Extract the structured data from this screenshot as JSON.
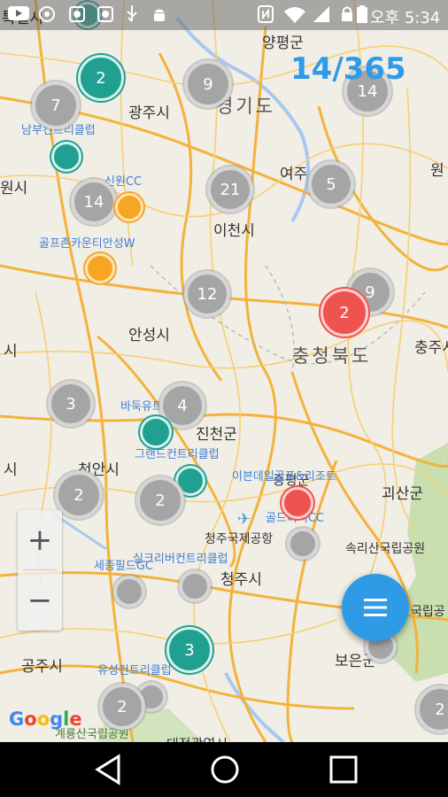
{
  "status": {
    "time": "오후 5:34",
    "left_text": "특별시"
  },
  "counter": "14/365",
  "places": [
    {
      "id": "yangpyeong",
      "text": "양평군"
    },
    {
      "id": "gyeonggi",
      "text": "경기도"
    },
    {
      "id": "gwangju",
      "text": "광주시"
    },
    {
      "id": "yeoju",
      "text": "여주"
    },
    {
      "id": "won",
      "text": "원"
    },
    {
      "id": "wonsi",
      "text": "원시"
    },
    {
      "id": "icheon",
      "text": "이천시"
    },
    {
      "id": "anseong",
      "text": "안성시"
    },
    {
      "id": "chungbuk",
      "text": "충청북도"
    },
    {
      "id": "chungju",
      "text": "충주시"
    },
    {
      "id": "si-left",
      "text": "시"
    },
    {
      "id": "jincheon",
      "text": "진천군"
    },
    {
      "id": "cheonan",
      "text": "천안시"
    },
    {
      "id": "si-left2",
      "text": "시"
    },
    {
      "id": "goesan",
      "text": "괴산군"
    },
    {
      "id": "jeungpyeong",
      "text": "증평군"
    },
    {
      "id": "airport",
      "text": "청주국제공항"
    },
    {
      "id": "cheongju",
      "text": "청주시"
    },
    {
      "id": "songnisan",
      "text": "속리산국립공원"
    },
    {
      "id": "gongju",
      "text": "공주시"
    },
    {
      "id": "boeun",
      "text": "보은군"
    },
    {
      "id": "national-park",
      "text": "국립공"
    },
    {
      "id": "daejeon",
      "text": "대전광역시"
    }
  ],
  "pois": [
    {
      "id": "nambu-cc",
      "text": "남부컨트리클럽"
    },
    {
      "id": "sinwon-cc",
      "text": "신원CC"
    },
    {
      "id": "golfzone",
      "text": "골프존카운티안성W"
    },
    {
      "id": "baduk",
      "text": "바둑유트GC"
    },
    {
      "id": "grand-cc",
      "text": "그랜드컨트리클럽"
    },
    {
      "id": "ilgong",
      "text": "이븐데일골프&리조트"
    },
    {
      "id": "golf-cc",
      "text": "골드리치CC"
    },
    {
      "id": "sejong",
      "text": "세종필드GC"
    },
    {
      "id": "silk-cc",
      "text": "실크리버컨트리클럽"
    },
    {
      "id": "yuseong",
      "text": "유성컨트리클럽"
    },
    {
      "id": "gyeryong",
      "text": "계룡산국립공원"
    }
  ],
  "markers": [
    {
      "id": "m-top-teal",
      "type": "teal",
      "label": ""
    },
    {
      "id": "m-2-teal",
      "type": "teal",
      "label": "2"
    },
    {
      "id": "m-7",
      "type": "gray",
      "label": "7"
    },
    {
      "id": "m-9-top",
      "type": "gray",
      "label": "9"
    },
    {
      "id": "m-14-top",
      "type": "gray",
      "label": "14"
    },
    {
      "id": "m-teal-a",
      "type": "teal",
      "label": ""
    },
    {
      "id": "m-14",
      "type": "gray",
      "label": "14"
    },
    {
      "id": "m-orange-a",
      "type": "orange",
      "label": ""
    },
    {
      "id": "m-21",
      "type": "gray",
      "label": "21"
    },
    {
      "id": "m-5",
      "type": "gray",
      "label": "5"
    },
    {
      "id": "m-orange-b",
      "type": "orange",
      "label": ""
    },
    {
      "id": "m-12",
      "type": "gray",
      "label": "12"
    },
    {
      "id": "m-9-right",
      "type": "gray",
      "label": "9"
    },
    {
      "id": "m-2-red",
      "type": "red",
      "label": "2"
    },
    {
      "id": "m-3",
      "type": "gray",
      "label": "3"
    },
    {
      "id": "m-4",
      "type": "gray",
      "label": "4"
    },
    {
      "id": "m-teal-b",
      "type": "teal",
      "label": ""
    },
    {
      "id": "m-teal-c",
      "type": "teal",
      "label": ""
    },
    {
      "id": "m-2-a",
      "type": "gray",
      "label": "2"
    },
    {
      "id": "m-2-b",
      "type": "gray",
      "label": "2"
    },
    {
      "id": "m-red-b",
      "type": "red",
      "label": ""
    },
    {
      "id": "m-gray-a",
      "type": "gray",
      "label": ""
    },
    {
      "id": "m-gray-b",
      "type": "gray",
      "label": ""
    },
    {
      "id": "m-gray-c",
      "type": "gray",
      "label": ""
    },
    {
      "id": "m-3-teal",
      "type": "teal",
      "label": "3"
    },
    {
      "id": "m-gray-d",
      "type": "gray",
      "label": ""
    },
    {
      "id": "m-2-bottom",
      "type": "gray",
      "label": "2"
    },
    {
      "id": "m-gray-e",
      "type": "gray",
      "label": ""
    },
    {
      "id": "m-2-edge",
      "type": "gray",
      "label": "2"
    }
  ],
  "zoom": {
    "in": "+",
    "out": "−"
  },
  "google": {
    "g1": "G",
    "o1": "o",
    "o2": "o",
    "g2": "g",
    "l": "l",
    "e": "e"
  },
  "colors": {
    "accent": "#2f9be6",
    "teal": "#20a090",
    "red": "#ef5350",
    "orange": "#f6a623",
    "gray": "#a5a5a5"
  }
}
